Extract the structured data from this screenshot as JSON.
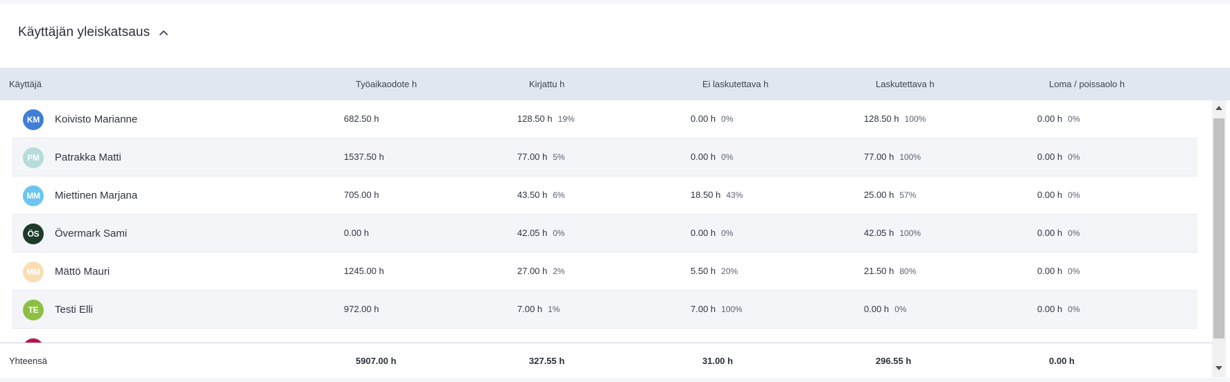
{
  "section": {
    "title": "Käyttäjän yleiskatsaus"
  },
  "columns": [
    "Käyttäjä",
    "Työaikaodote h",
    "Kirjattu h",
    "Ei laskutettava h",
    "Laskutettava h",
    "Loma / poissaolo h"
  ],
  "rows": [
    {
      "initials": "KM",
      "avatar_color": "#3f7fd6",
      "name": "Koivisto Marianne",
      "expected": "682.50 h",
      "logged": "128.50 h",
      "logged_pct": "19%",
      "nonbill": "0.00 h",
      "nonbill_pct": "0%",
      "bill": "128.50 h",
      "bill_pct": "100%",
      "leave": "0.00 h",
      "leave_pct": "0%"
    },
    {
      "initials": "PM",
      "avatar_color": "#b7dcd9",
      "name": "Patrakka Matti",
      "expected": "1537.50 h",
      "logged": "77.00 h",
      "logged_pct": "5%",
      "nonbill": "0.00 h",
      "nonbill_pct": "0%",
      "bill": "77.00 h",
      "bill_pct": "100%",
      "leave": "0.00 h",
      "leave_pct": "0%"
    },
    {
      "initials": "MM",
      "avatar_color": "#6cc4f1",
      "name": "Miettinen Marjana",
      "expected": "705.00 h",
      "logged": "43.50 h",
      "logged_pct": "6%",
      "nonbill": "18.50 h",
      "nonbill_pct": "43%",
      "bill": "25.00 h",
      "bill_pct": "57%",
      "leave": "0.00 h",
      "leave_pct": "0%"
    },
    {
      "initials": "ÖS",
      "avatar_color": "#1e3a2b",
      "name": "Övermark Sami",
      "expected": "0.00 h",
      "logged": "42.05 h",
      "logged_pct": "0%",
      "nonbill": "0.00 h",
      "nonbill_pct": "0%",
      "bill": "42.05 h",
      "bill_pct": "100%",
      "leave": "0.00 h",
      "leave_pct": "0%"
    },
    {
      "initials": "MM",
      "avatar_color": "#f9deb4",
      "name": "Mättö Mauri",
      "expected": "1245.00 h",
      "logged": "27.00 h",
      "logged_pct": "2%",
      "nonbill": "5.50 h",
      "nonbill_pct": "20%",
      "bill": "21.50 h",
      "bill_pct": "80%",
      "leave": "0.00 h",
      "leave_pct": "0%"
    },
    {
      "initials": "TE",
      "avatar_color": "#8cc043",
      "name": "Testi Elli",
      "expected": "972.00 h",
      "logged": "7.00 h",
      "logged_pct": "1%",
      "nonbill": "7.00 h",
      "nonbill_pct": "100%",
      "bill": "0.00 h",
      "bill_pct": "0%",
      "leave": "0.00 h",
      "leave_pct": "0%"
    }
  ],
  "totals": {
    "label": "Yhteensä",
    "expected": "5907.00 h",
    "logged": "327.55 h",
    "nonbill": "31.00 h",
    "bill": "296.55 h",
    "leave": "0.00 h"
  },
  "icons": {
    "collapse": "chevron-up-icon",
    "scroll_up": "scroll-up-arrow-icon",
    "scroll_down": "scroll-down-arrow-icon"
  }
}
